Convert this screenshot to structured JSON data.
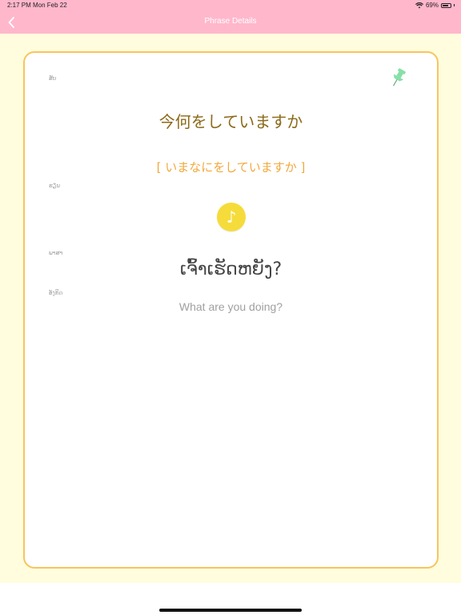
{
  "status_bar": {
    "time": "2:17 PM",
    "date": "Mon Feb 22",
    "battery": "69%",
    "icons": [
      "wifi-icon",
      "battery-icon"
    ]
  },
  "nav": {
    "title": "Phrase Details",
    "back_icon": "chevron-left-icon"
  },
  "colors": {
    "nav_bg": "#ffb7cc",
    "content_bg": "#fffddd",
    "card_border": "#f7c55e",
    "japanese_text": "#8c6a1a",
    "reading_text": "#f2a93c",
    "audio_button": "#f5dc3a"
  },
  "phrase": {
    "labels": {
      "phrase": "ສັບ",
      "reading": "ຮຽນ",
      "lao": "ພາສາ",
      "meaning": "ອັງກິດ"
    },
    "japanese": "今何をしていますか",
    "reading": "[ いまなにをしていますか ]",
    "lao": "ເຈົ້າເຮັດຫຍັງ?",
    "english": "What are you doing?",
    "audio_icon": "music-note-icon",
    "pin_icon": "pushpin-icon"
  }
}
